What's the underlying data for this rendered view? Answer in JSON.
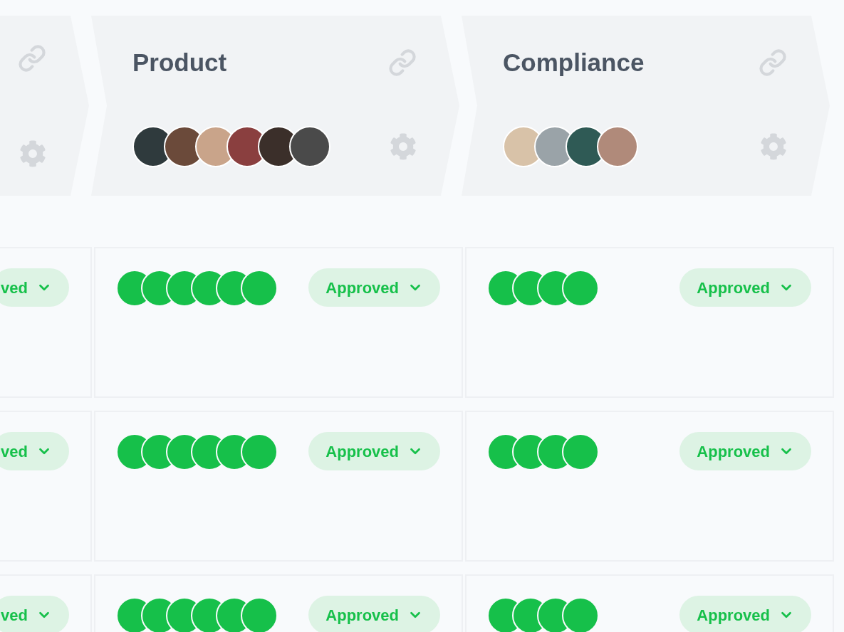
{
  "stages": [
    {
      "link": true,
      "settings": true
    },
    {
      "title": "Product",
      "link": true,
      "settings": true,
      "avatars": [
        {
          "color": "#2f3a3d"
        },
        {
          "color": "#6b4a3a"
        },
        {
          "color": "#c9a48a"
        },
        {
          "color": "#8a3f3f"
        },
        {
          "color": "#3b2f2a"
        },
        {
          "color": "#4a4a4a"
        }
      ]
    },
    {
      "title": "Compliance",
      "link": true,
      "settings": true,
      "avatars": [
        {
          "color": "#d8c2a8"
        },
        {
          "color": "#9aa3a8"
        },
        {
          "color": "#2f5a55"
        },
        {
          "color": "#b08a7a"
        }
      ]
    }
  ],
  "rows": [
    {
      "cells": [
        {
          "status": {
            "label": "ved",
            "kind": "approved"
          }
        },
        {
          "reviewers": [
            {
              "approved": true
            },
            {
              "approved": true
            },
            {
              "approved": true
            },
            {
              "approved": true
            },
            {
              "approved": true
            },
            {
              "approved": true
            }
          ],
          "status": {
            "label": "Approved",
            "kind": "approved"
          }
        },
        {
          "reviewers": [
            {
              "approved": true
            },
            {
              "approved": true
            },
            {
              "approved": true
            },
            {
              "approved": true
            }
          ],
          "status": {
            "label": "Approved",
            "kind": "approved"
          }
        }
      ]
    },
    {
      "cells": [
        {
          "status": {
            "label": "ved",
            "kind": "approved"
          }
        },
        {
          "reviewers": [
            {
              "approved": true
            },
            {
              "approved": true
            },
            {
              "approved": true
            },
            {
              "approved": true
            },
            {
              "approved": true
            },
            {
              "approved": true
            }
          ],
          "status": {
            "label": "Approved",
            "kind": "approved"
          }
        },
        {
          "reviewers": [
            {
              "approved": true
            },
            {
              "approved": true
            },
            {
              "approved": true
            },
            {
              "approved": true
            }
          ],
          "status": {
            "label": "Approved",
            "kind": "approved"
          }
        }
      ]
    },
    {
      "cells": [
        {
          "status": {
            "label": "ved",
            "kind": "approved"
          }
        },
        {
          "reviewers": [
            {
              "approved": true
            },
            {
              "approved": true
            },
            {
              "approved": true
            },
            {
              "approved": true
            },
            {
              "approved": true
            },
            {
              "approved": true
            }
          ],
          "status": {
            "label": "Approved",
            "kind": "approved"
          }
        },
        {
          "reviewers": [
            {
              "approved": true
            },
            {
              "approved": true
            },
            {
              "approved": true
            },
            {
              "approved": true
            }
          ],
          "status": {
            "label": "Approved",
            "kind": "approved"
          }
        }
      ]
    }
  ]
}
